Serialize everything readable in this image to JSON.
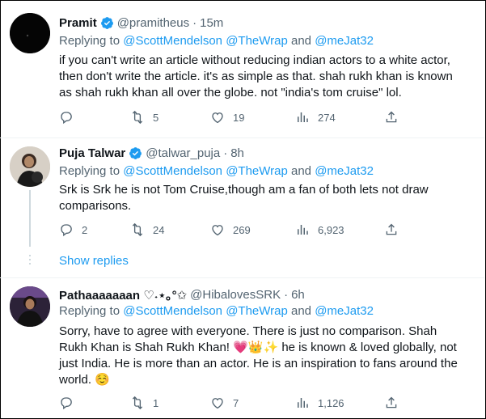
{
  "tweets": [
    {
      "name": "Pramit",
      "handle": "@pramitheus",
      "separator": "·",
      "time": "15m",
      "replying_prefix": "Replying to ",
      "mentions": [
        "@ScottMendelson",
        "@TheWrap",
        "@meJat32"
      ],
      "mention_joiner_and": "and",
      "text": "if you can't write an article without reducing indian actors to a white actor, then don't write the article. it's as simple as that. shah rukh khan is known as shah rukh khan all over the globe. not \"india's tom cruise\" lol.",
      "retweets": "5",
      "likes": "19",
      "views": "274"
    },
    {
      "name": "Puja Talwar",
      "handle": "@talwar_puja",
      "separator": "·",
      "time": "8h",
      "replying_prefix": "Replying to ",
      "mentions": [
        "@ScottMendelson",
        "@TheWrap",
        "@meJat32"
      ],
      "mention_joiner_and": "and",
      "text": "Srk is Srk he is not Tom Cruise,though am a fan of both lets not draw comparisons.",
      "replies": "2",
      "retweets": "24",
      "likes": "269",
      "views": "6,923"
    },
    {
      "name": "Pathaaaaaaan ♡˖⋆｡°✩",
      "handle": "@HibalovesSRK",
      "separator": "·",
      "time": "6h",
      "replying_prefix": "Replying to ",
      "mentions": [
        "@ScottMendelson",
        "@TheWrap",
        "@meJat32"
      ],
      "mention_joiner_and": "and",
      "text": "Sorry, have to agree with everyone. There is just no comparison. Shah Rukh Khan is Shah Rukh Khan! 💗👑✨ he is known & loved globally, not just India. He is more than an actor. He is an inspiration to fans around the world. ☺️",
      "retweets": "1",
      "likes": "7",
      "views": "1,126"
    }
  ],
  "show_replies_label": "Show replies",
  "colors": {
    "link": "#1d9bf0",
    "muted": "#536471",
    "text": "#0f1419",
    "verified": "#1d9bf0"
  },
  "icons": [
    "verified-badge-icon",
    "reply-icon",
    "retweet-icon",
    "like-icon",
    "views-icon",
    "share-icon"
  ]
}
